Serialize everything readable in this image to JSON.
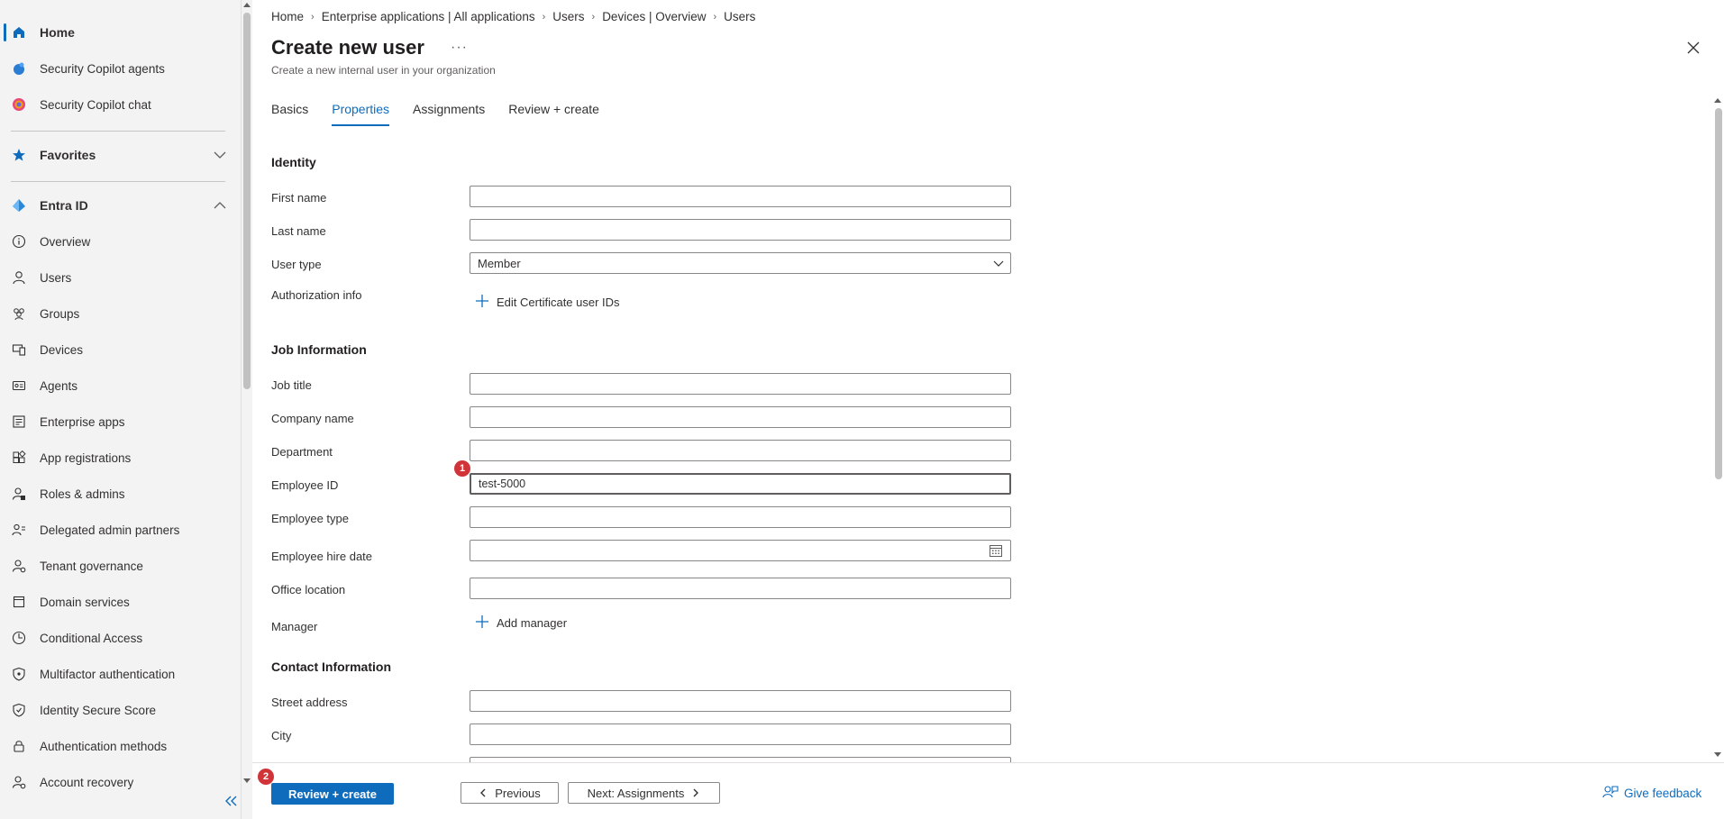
{
  "sidebar": {
    "items": [
      {
        "label": "Home",
        "icon": "home-icon"
      },
      {
        "label": "Security Copilot agents",
        "icon": "copilot-agents-icon"
      },
      {
        "label": "Security Copilot chat",
        "icon": "copilot-chat-icon"
      },
      {
        "label": "Favorites",
        "icon": "star-icon"
      },
      {
        "label": "Entra ID",
        "icon": "entra-icon"
      },
      {
        "label": "Overview",
        "icon": "info-icon"
      },
      {
        "label": "Users",
        "icon": "user-icon"
      },
      {
        "label": "Groups",
        "icon": "groups-icon"
      },
      {
        "label": "Devices",
        "icon": "devices-icon"
      },
      {
        "label": "Agents",
        "icon": "agents-icon"
      },
      {
        "label": "Enterprise apps",
        "icon": "enterprise-apps-icon"
      },
      {
        "label": "App registrations",
        "icon": "app-registrations-icon"
      },
      {
        "label": "Roles & admins",
        "icon": "roles-icon"
      },
      {
        "label": "Delegated admin partners",
        "icon": "partners-icon"
      },
      {
        "label": "Tenant governance",
        "icon": "tenant-governance-icon"
      },
      {
        "label": "Domain services",
        "icon": "domain-services-icon"
      },
      {
        "label": "Conditional Access",
        "icon": "conditional-access-icon"
      },
      {
        "label": "Multifactor authentication",
        "icon": "shield-icon"
      },
      {
        "label": "Identity Secure Score",
        "icon": "secure-score-icon"
      },
      {
        "label": "Authentication methods",
        "icon": "auth-methods-icon"
      },
      {
        "label": "Account recovery",
        "icon": "account-recovery-icon"
      }
    ]
  },
  "breadcrumb": [
    "Home",
    "Enterprise applications | All applications",
    "Users",
    "Devices | Overview",
    "Users"
  ],
  "header": {
    "title": "Create new user",
    "more": "···",
    "subtitle": "Create a new internal user in your organization"
  },
  "tabs": [
    "Basics",
    "Properties",
    "Assignments",
    "Review + create"
  ],
  "form": {
    "identity_heading": "Identity",
    "first_name_label": "First name",
    "first_name_value": "",
    "last_name_label": "Last name",
    "last_name_value": "",
    "user_type_label": "User type",
    "user_type_value": "Member",
    "authorization_label": "Authorization info",
    "edit_cert_label": "Edit Certificate user IDs",
    "job_heading": "Job Information",
    "job_title_label": "Job title",
    "company_name_label": "Company name",
    "department_label": "Department",
    "employee_id_label": "Employee ID",
    "employee_id_value": "test-5000",
    "employee_type_label": "Employee type",
    "hire_date_label": "Employee hire date",
    "office_label": "Office location",
    "manager_label": "Manager",
    "add_manager_label": "Add manager",
    "contact_heading": "Contact Information",
    "street_label": "Street address",
    "city_label": "City"
  },
  "badges": {
    "employee_id": "1",
    "review": "2"
  },
  "footer": {
    "review_label": "Review + create",
    "previous_label": "Previous",
    "next_label": "Next: Assignments",
    "feedback_label": "Give feedback"
  },
  "colors": {
    "accent": "#0f6cbd",
    "badge": "#d13438"
  }
}
